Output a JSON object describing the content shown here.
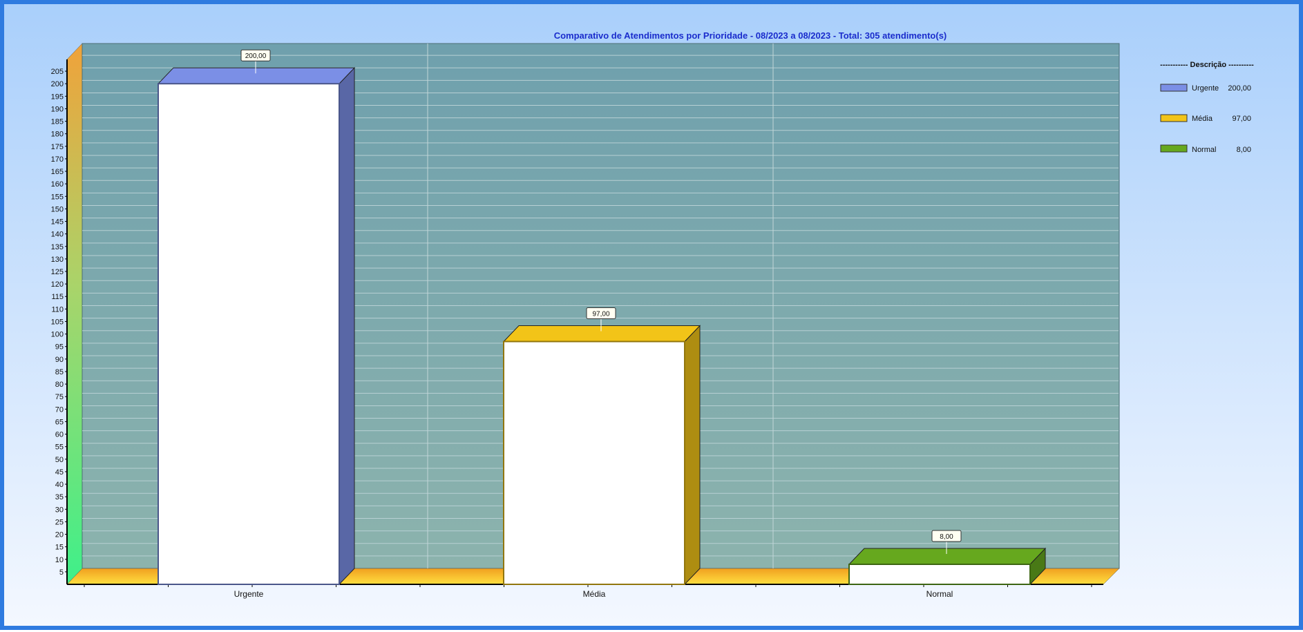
{
  "chart_data": {
    "type": "bar",
    "title": "Comparativo de Atendimentos por Prioridade - 08/2023 a 08/2023 - Total: 305 atendimento(s)",
    "categories": [
      "Urgente",
      "Média",
      "Normal"
    ],
    "values": [
      200,
      97,
      8
    ],
    "value_labels": [
      "200,00",
      "97,00",
      "8,00"
    ],
    "colors": [
      "#7b8fe6",
      "#f2c418",
      "#66a81e"
    ],
    "ylim": [
      0,
      205
    ],
    "ytick_step": 5,
    "grid": true,
    "legend": {
      "position": "right",
      "title": "Descrição",
      "title_display": "----------- Descrição ----------",
      "entries": [
        {
          "label": "Urgente",
          "value": "200,00"
        },
        {
          "label": "Média",
          "value": "97,00"
        },
        {
          "label": "Normal",
          "value": "8,00"
        }
      ]
    }
  }
}
